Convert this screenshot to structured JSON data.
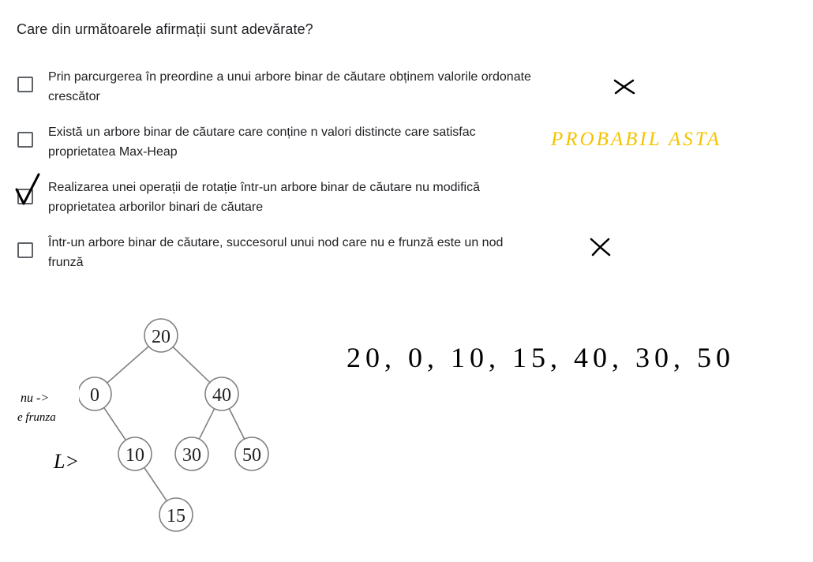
{
  "question": "Care din următoarele afirmații sunt adevărate?",
  "options": [
    {
      "line1": "Prin parcurgerea în preordine a unui arbore binar de căutare obținem valorile ordonate",
      "line2": "crescător",
      "checked": false,
      "annotation": "✕"
    },
    {
      "line1": "Există un arbore binar de căutare care conține n valori distincte care satisfac",
      "line2": "proprietatea Max-Heap",
      "checked": false,
      "annotation": "PROBABIL ASTA"
    },
    {
      "line1": "Realizarea unei operații de rotație într-un arbore binar de căutare nu modifică",
      "line2": "proprietatea arborilor binari de căutare",
      "checked": true,
      "annotation": "✓"
    },
    {
      "line1": "Într-un arbore binar de căutare, succesorul unui nod care nu e frunză este un nod",
      "line2": "frunză",
      "checked": false,
      "annotation": "✕"
    }
  ],
  "tree": {
    "nodes": [
      "20",
      "0",
      "40",
      "10",
      "30",
      "50",
      "15"
    ]
  },
  "handwriting": {
    "preorder": "20, 0, 10, 15, 40, 30, 50",
    "note1": "nu ->",
    "note2": "e frunza",
    "note3": "L>"
  },
  "colors": {
    "annotation_yellow": "#f5c400",
    "ink": "#000000",
    "node_border": "#808080"
  }
}
